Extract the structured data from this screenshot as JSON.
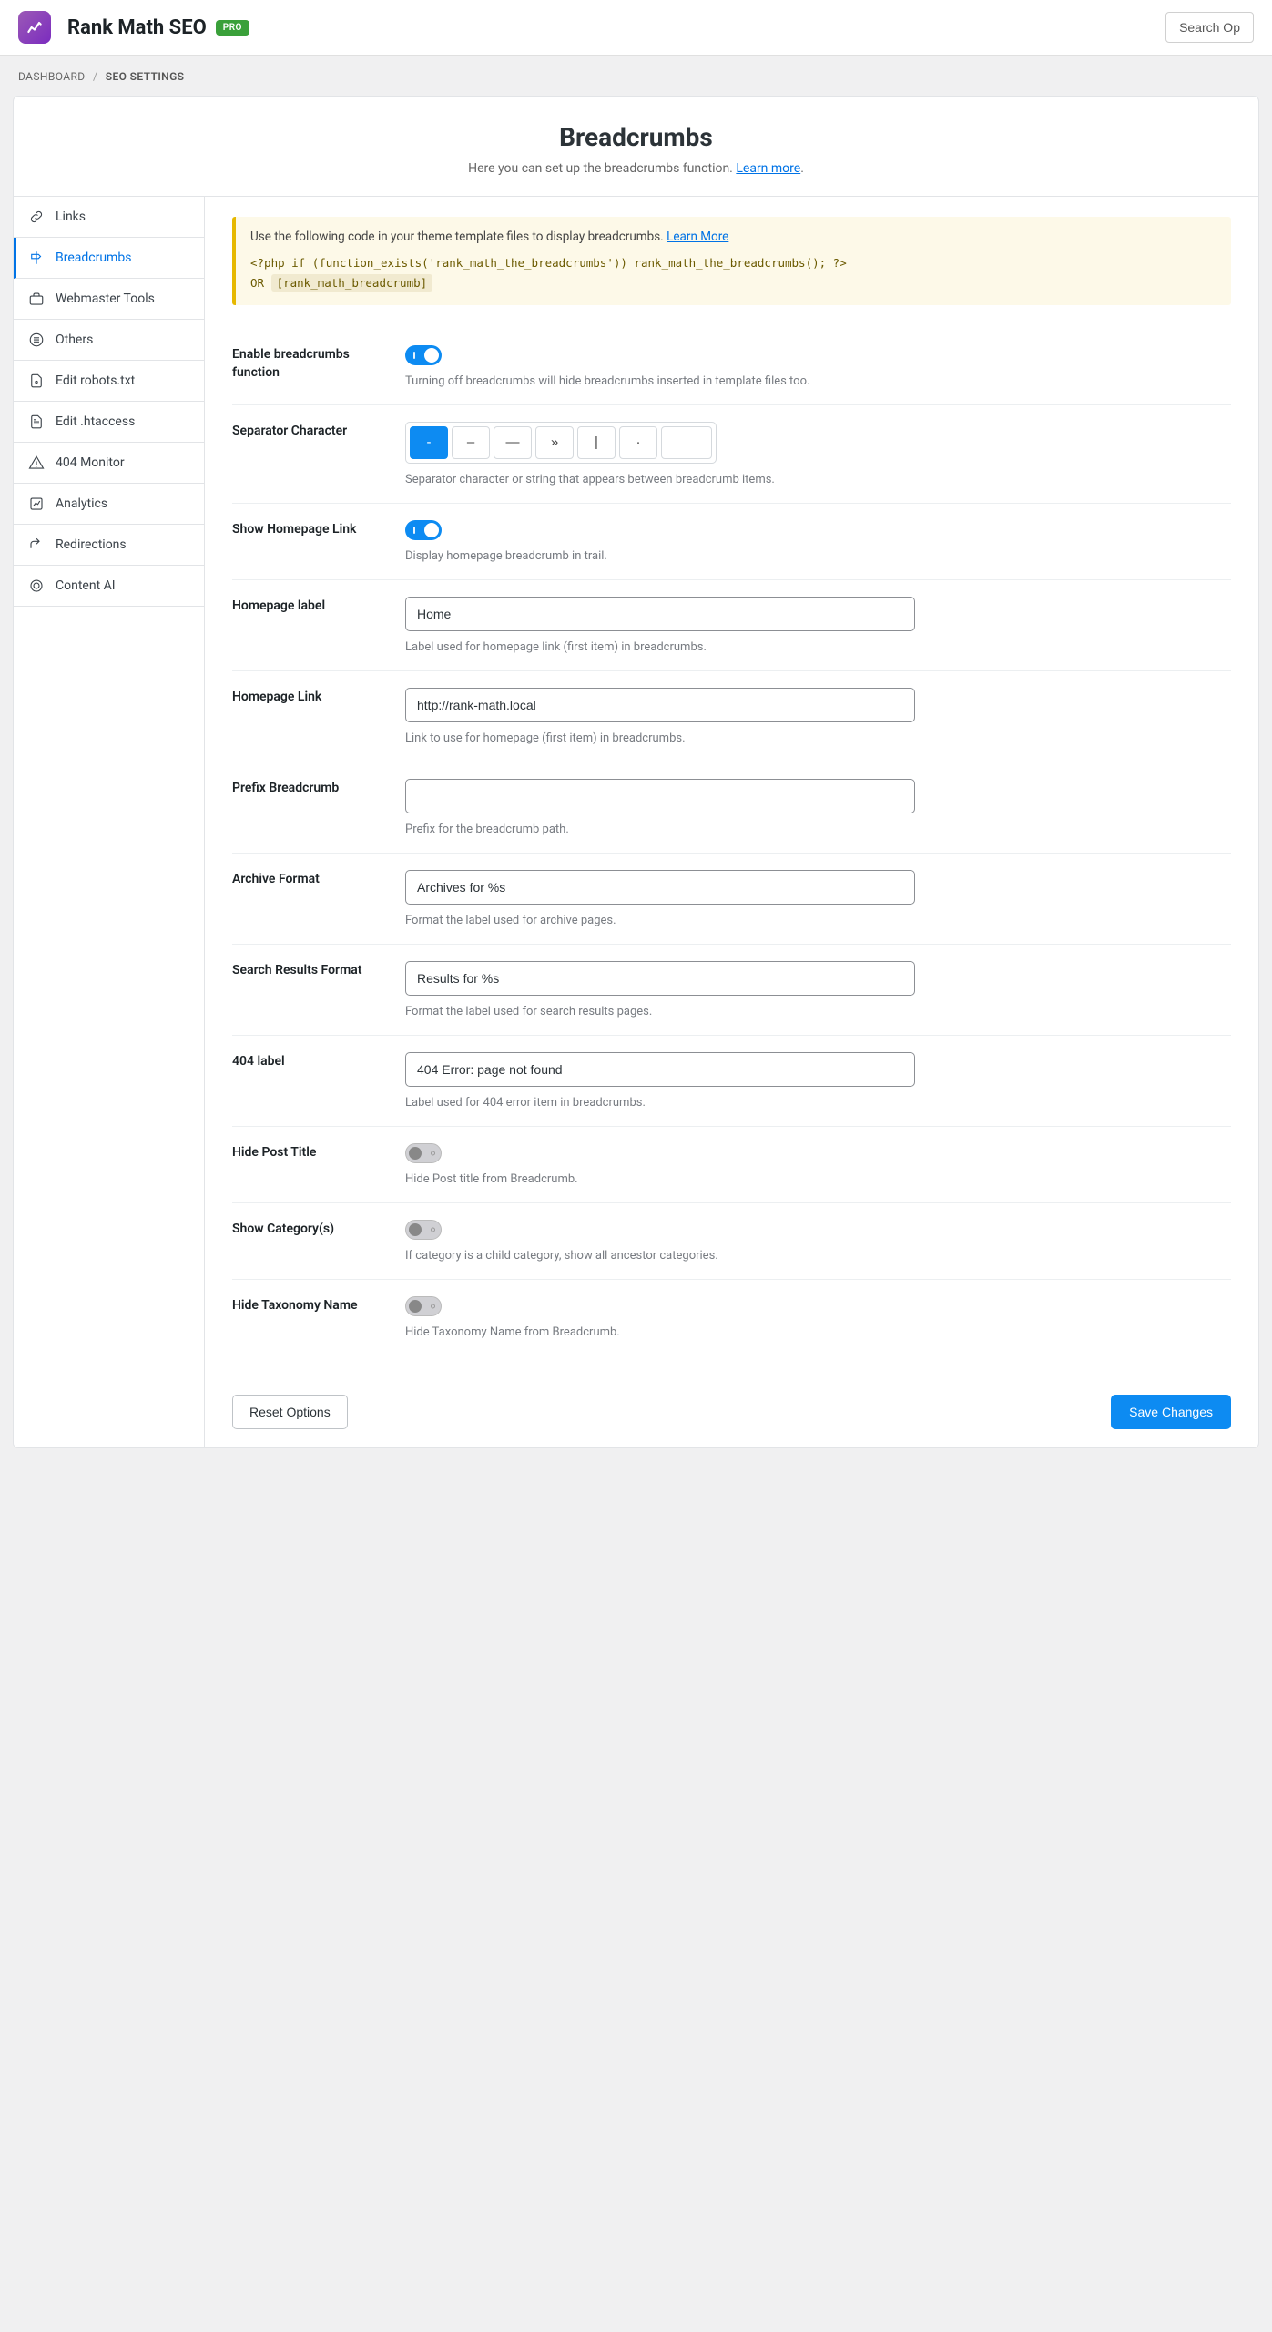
{
  "header": {
    "app_title": "Rank Math SEO",
    "pro_badge": "PRO",
    "search_label": "Search Op"
  },
  "crumb": {
    "dashboard": "DASHBOARD",
    "current": "SEO SETTINGS"
  },
  "page": {
    "title": "Breadcrumbs",
    "subtitle_pre": "Here you can set up the breadcrumbs function. ",
    "learn_more": "Learn more"
  },
  "sidebar": {
    "items": [
      {
        "id": "links",
        "label": "Links"
      },
      {
        "id": "breadcrumbs",
        "label": "Breadcrumbs",
        "active": true
      },
      {
        "id": "webmaster",
        "label": "Webmaster Tools"
      },
      {
        "id": "others",
        "label": "Others"
      },
      {
        "id": "robots",
        "label": "Edit robots.txt"
      },
      {
        "id": "htaccess",
        "label": "Edit .htaccess"
      },
      {
        "id": "404",
        "label": "404 Monitor"
      },
      {
        "id": "analytics",
        "label": "Analytics"
      },
      {
        "id": "redirections",
        "label": "Redirections"
      },
      {
        "id": "contentai",
        "label": "Content AI"
      }
    ]
  },
  "notice": {
    "text_pre": "Use the following code in your theme template files to display breadcrumbs. ",
    "learn_more": "Learn More",
    "code_line": "<?php if (function_exists('rank_math_the_breadcrumbs')) rank_math_the_breadcrumbs(); ?>",
    "or": " OR ",
    "shortcode": "[rank_math_breadcrumb]"
  },
  "fields": {
    "enable": {
      "label": "Enable breadcrumbs function",
      "desc": "Turning off breadcrumbs will hide breadcrumbs inserted in template files too.",
      "on": true
    },
    "separator": {
      "label": "Separator Character",
      "desc": "Separator character or string that appears between breadcrumb items.",
      "options": [
        "-",
        "–",
        "—",
        "»",
        "|",
        "·",
        ""
      ],
      "selected": 0
    },
    "homepage_link_show": {
      "label": "Show Homepage Link",
      "desc": "Display homepage breadcrumb in trail.",
      "on": true
    },
    "homepage_label": {
      "label": "Homepage label",
      "value": "Home",
      "desc": "Label used for homepage link (first item) in breadcrumbs."
    },
    "homepage_link": {
      "label": "Homepage Link",
      "value": "http://rank-math.local",
      "desc": "Link to use for homepage (first item) in breadcrumbs."
    },
    "prefix": {
      "label": "Prefix Breadcrumb",
      "value": "",
      "desc": "Prefix for the breadcrumb path."
    },
    "archive_format": {
      "label": "Archive Format",
      "value": "Archives for %s",
      "desc": "Format the label used for archive pages."
    },
    "search_format": {
      "label": "Search Results Format",
      "value": "Results for %s",
      "desc": "Format the label used for search results pages."
    },
    "label_404": {
      "label": "404 label",
      "value": "404 Error: page not found",
      "desc": "Label used for 404 error item in breadcrumbs."
    },
    "hide_post_title": {
      "label": "Hide Post Title",
      "desc": "Hide Post title from Breadcrumb.",
      "on": false
    },
    "show_category": {
      "label": "Show Category(s)",
      "desc": "If category is a child category, show all ancestor categories.",
      "on": false
    },
    "hide_taxonomy": {
      "label": "Hide Taxonomy Name",
      "desc": "Hide Taxonomy Name from Breadcrumb.",
      "on": false
    }
  },
  "footer": {
    "reset": "Reset Options",
    "save": "Save Changes"
  }
}
